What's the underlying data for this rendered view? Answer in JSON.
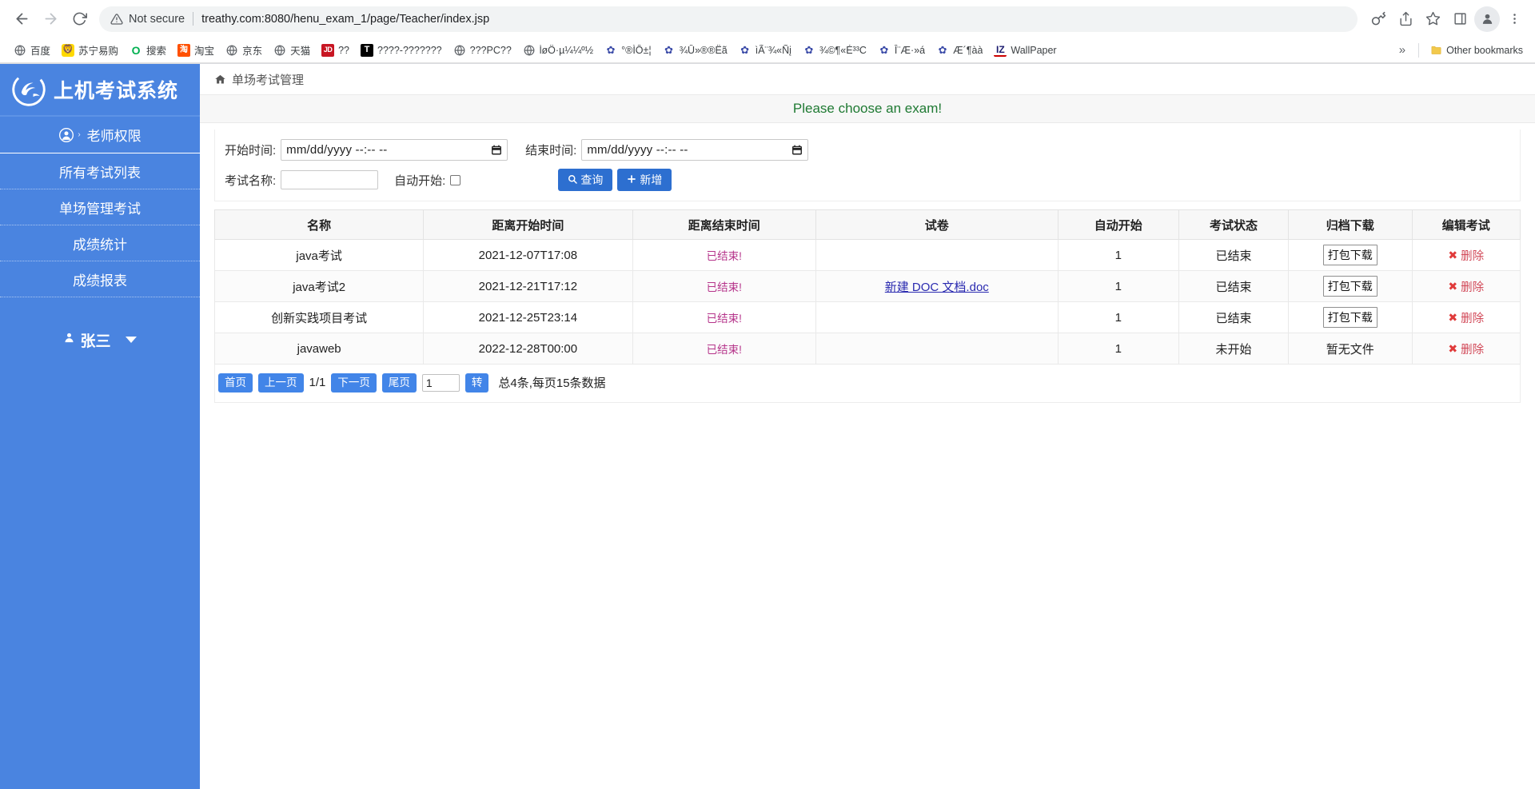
{
  "browser": {
    "back_icon": "back-arrow-icon",
    "forward_icon": "forward-arrow-icon",
    "reload_icon": "reload-icon",
    "security_label": "Not secure",
    "url": "treathy.com:8080/henu_exam_1/page/Teacher/index.jsp",
    "toolbar_icons": [
      "key-icon",
      "share-icon",
      "star-icon",
      "side-panel-icon",
      "profile-avatar-icon",
      "three-dot-menu-icon"
    ],
    "bookmarks": [
      {
        "label": "百度",
        "icon": "globe-icon",
        "icon_kind": "globe"
      },
      {
        "label": "苏宁易购",
        "icon": "suning-icon",
        "icon_kind": "suning",
        "glyph": "🦁"
      },
      {
        "label": "搜索",
        "icon": "search-o-icon",
        "icon_kind": "search",
        "glyph": "O"
      },
      {
        "label": "淘宝",
        "icon": "taobao-icon",
        "icon_kind": "taobao",
        "glyph": "淘"
      },
      {
        "label": "京东",
        "icon": "globe-icon",
        "icon_kind": "globe"
      },
      {
        "label": "天猫",
        "icon": "globe-icon",
        "icon_kind": "globe"
      },
      {
        "label": "??",
        "icon": "jd-icon",
        "icon_kind": "jd",
        "glyph": "JD"
      },
      {
        "label": "????-???????",
        "icon": "t-icon",
        "icon_kind": "t",
        "glyph": "T"
      },
      {
        "label": "???PC??",
        "icon": "globe-icon",
        "icon_kind": "globe"
      },
      {
        "label": "ĺøÖ·µ¼¼º½",
        "icon": "globe-icon",
        "icon_kind": "globe"
      },
      {
        "label": "°®ÌÔ±¦",
        "icon": "paw-icon",
        "icon_kind": "paw",
        "glyph": "✿"
      },
      {
        "label": "¾Û»®®Ëã",
        "icon": "paw-icon",
        "icon_kind": "paw",
        "glyph": "✿"
      },
      {
        "label": "ìÃ¨¾«Ñį",
        "icon": "paw-icon",
        "icon_kind": "paw",
        "glyph": "✿"
      },
      {
        "label": "¾©¶«É³³C",
        "icon": "paw-icon",
        "icon_kind": "paw",
        "glyph": "✿"
      },
      {
        "label": "Î¨Æ·»á",
        "icon": "paw-icon",
        "icon_kind": "paw",
        "glyph": "✿"
      },
      {
        "label": "Æ´¶àà",
        "icon": "paw-icon",
        "icon_kind": "paw",
        "glyph": "✿"
      },
      {
        "label": "WallPaper",
        "icon": "iz-icon",
        "icon_kind": "iz",
        "glyph": "IZ"
      }
    ],
    "overflow_label": "»",
    "other_bookmarks_label": "Other bookmarks",
    "other_bookmarks_icon": "folder-icon"
  },
  "sidebar": {
    "brand": "上机考试系统",
    "brand_logo": "swirl-logo-icon",
    "top_item": {
      "label": "老师权限",
      "icon": "person-circle-icon",
      "caret": "›"
    },
    "items": [
      {
        "label": "所有考试列表"
      },
      {
        "label": "单场管理考试"
      },
      {
        "label": "成绩统计"
      },
      {
        "label": "成绩报表"
      }
    ],
    "user": {
      "name": "张三",
      "icon": "user-icon",
      "caret_icon": "chevron-down-icon"
    },
    "bg_color": "#4a84e0"
  },
  "main": {
    "breadcrumb": {
      "icon": "home-icon",
      "label": "单场考试管理"
    },
    "alert": {
      "text": "Please choose an exam!",
      "color": "#1f7a33"
    },
    "filters": {
      "start_time_label": "开始时间:",
      "start_time_placeholder": "mm/dd/yyyy --:-- --",
      "start_time_value": "",
      "end_time_label": "结束时间:",
      "end_time_placeholder": "mm/dd/yyyy --:-- --",
      "end_time_value": "",
      "exam_name_label": "考试名称:",
      "exam_name_value": "",
      "auto_start_label": "自动开始:",
      "auto_start_checked": false,
      "search_button": "查询",
      "search_icon": "search-icon",
      "add_button": "新增",
      "add_icon": "plus-icon",
      "button_color": "#2d6fd0"
    },
    "table": {
      "headers": [
        "名称",
        "距离开始时间",
        "距离结束时间",
        "试卷",
        "自动开始",
        "考试状态",
        "归档下载",
        "编辑考试"
      ],
      "rows": [
        {
          "name": "java考试",
          "start": "2021-12-07T17:08",
          "end": "已结束!",
          "paper": "",
          "auto": "1",
          "status": "已结束",
          "download": "打包下载",
          "download_kind": "button",
          "edit": "删除"
        },
        {
          "name": "java考试2",
          "start": "2021-12-21T17:12",
          "end": "已结束!",
          "paper": "新建 DOC 文档.doc",
          "auto": "1",
          "status": "已结束",
          "download": "打包下载",
          "download_kind": "button",
          "edit": "删除"
        },
        {
          "name": "创新实践项目考试",
          "start": "2021-12-25T23:14",
          "end": "已结束!",
          "paper": "",
          "auto": "1",
          "status": "已结束",
          "download": "打包下载",
          "download_kind": "button",
          "edit": "删除"
        },
        {
          "name": "javaweb",
          "start": "2022-12-28T00:00",
          "end": "已结束!",
          "paper": "",
          "auto": "1",
          "status": "未开始",
          "download": "暂无文件",
          "download_kind": "text",
          "edit": "删除"
        }
      ]
    },
    "pagination": {
      "first": "首页",
      "prev": "上一页",
      "page_indicator": "1/1",
      "next": "下一页",
      "last": "尾页",
      "jump_value": "1",
      "go": "转",
      "summary": "总4条,每页15条数据"
    }
  }
}
